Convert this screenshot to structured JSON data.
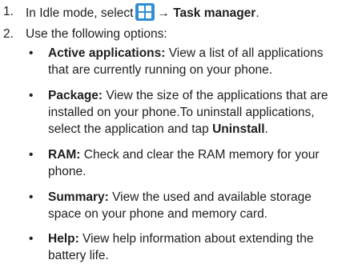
{
  "steps": [
    {
      "number": "1.",
      "before_icon": "In Idle mode, select",
      "icon": "apps-grid-icon",
      "arrow": "→",
      "bold": "Task manager",
      "after": "."
    },
    {
      "number": "2.",
      "text": "Use the following options:"
    }
  ],
  "options": [
    {
      "bullet": "•",
      "term": "Active applications:",
      "lines": [
        " View a list of all applications",
        "that are currently running on your phone."
      ]
    },
    {
      "bullet": "•",
      "term": "Package:",
      "lines": [
        " View the size of the applications that are",
        "installed on your phone.To uninstall applications,",
        "select the application and tap "
      ],
      "bold_end": "Uninstall",
      "end": "."
    },
    {
      "bullet": "•",
      "term": "RAM:",
      "lines": [
        " Check and clear the RAM memory for your",
        "phone."
      ]
    },
    {
      "bullet": "•",
      "term": "Summary:",
      "lines": [
        " View the used and available storage",
        "space on your phone and memory card."
      ]
    },
    {
      "bullet": "•",
      "term": "Help:",
      "lines": [
        " View help information about extending the",
        "battery life."
      ]
    }
  ],
  "colors": {
    "icon_bg": "#2f8fd3",
    "text": "#1e1e1e"
  }
}
